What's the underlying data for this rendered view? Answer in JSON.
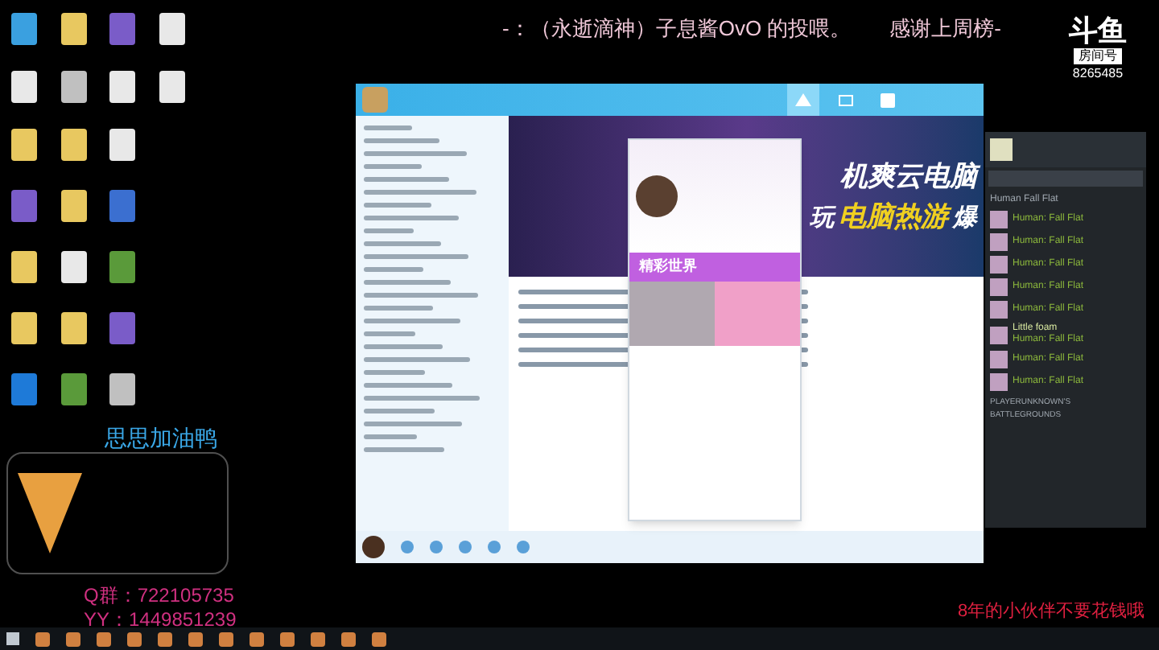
{
  "stream_banner": {
    "message": "-：（永逝滴神）子息酱OvO 的投喂。",
    "thanks": "感谢上周榜-"
  },
  "logo": {
    "brand": "斗鱼",
    "room_label": "房间号",
    "room_number": "8265485"
  },
  "desktop_icons": [
    {
      "kind": "pc"
    },
    {
      "kind": "folder"
    },
    {
      "kind": "app"
    },
    {
      "kind": "file"
    },
    {
      "kind": "file"
    },
    {
      "kind": "tool"
    },
    {
      "kind": "file"
    },
    {
      "kind": "file"
    },
    {
      "kind": "folder"
    },
    {
      "kind": "folder"
    },
    {
      "kind": "file"
    },
    {
      "kind": "empty"
    },
    {
      "kind": "app"
    },
    {
      "kind": "folder"
    },
    {
      "kind": "doc"
    },
    {
      "kind": "empty"
    },
    {
      "kind": "folder"
    },
    {
      "kind": "file"
    },
    {
      "kind": "game"
    },
    {
      "kind": "empty"
    },
    {
      "kind": "folder"
    },
    {
      "kind": "folder"
    },
    {
      "kind": "app"
    },
    {
      "kind": "empty"
    },
    {
      "kind": "remote"
    },
    {
      "kind": "game"
    },
    {
      "kind": "tool"
    },
    {
      "kind": "empty"
    }
  ],
  "chat_window": {
    "title_tabs": [
      {
        "kind": "home",
        "selected": true
      },
      {
        "kind": "screen",
        "selected": false
      },
      {
        "kind": "grid",
        "selected": false
      }
    ],
    "banner": {
      "line1": "机爽云电脑",
      "line2_prefix": "玩",
      "line2_highlight": "电脑热游",
      "line2_suffix": "爆"
    },
    "popup": {
      "promo": "精彩世界"
    }
  },
  "steam_friends": {
    "game_header": "Human Fall Flat",
    "friends": [
      {
        "status": "Human: Fall Flat"
      },
      {
        "status": "Human: Fall Flat"
      },
      {
        "status": "Human: Fall Flat"
      },
      {
        "status": "Human: Fall Flat"
      },
      {
        "status": "Human: Fall Flat"
      },
      {
        "name": "Little foam",
        "status": "Human: Fall Flat"
      },
      {
        "status": "Human: Fall Flat"
      },
      {
        "status": "Human: Fall Flat"
      }
    ],
    "group2": "PLAYERUNKNOWN'S BATTLEGROUNDS"
  },
  "overlay": {
    "title": "思思加油鸭",
    "qq_group": "Q群：722105735",
    "yy": "YY：1449851239",
    "notice": "8年的小伙伴不要花钱哦"
  }
}
